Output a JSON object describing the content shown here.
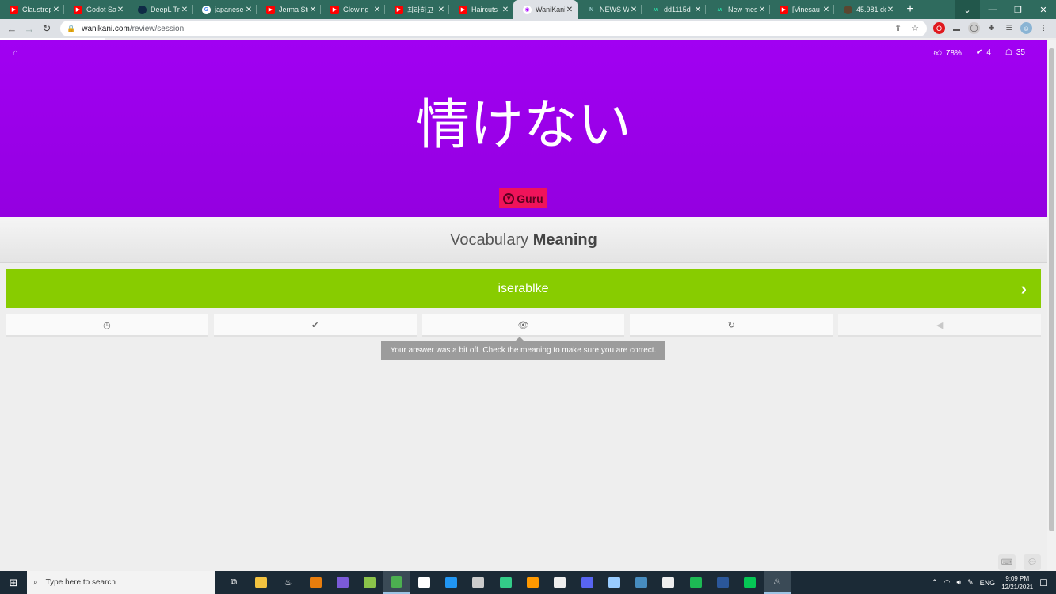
{
  "browser": {
    "tabs": [
      {
        "label": "Claustrop",
        "icon": "youtube-icon"
      },
      {
        "label": "Godot Sa",
        "icon": "youtube-icon"
      },
      {
        "label": "DeepL Tra",
        "icon": "deepl-icon"
      },
      {
        "label": "japanese",
        "icon": "google-icon"
      },
      {
        "label": "Jerma Str",
        "icon": "youtube-icon"
      },
      {
        "label": "Glowing",
        "icon": "youtube-icon"
      },
      {
        "label": "최라하고",
        "icon": "youtube-icon"
      },
      {
        "label": "Haircuts",
        "icon": "youtube-icon"
      },
      {
        "label": "WaniKani",
        "icon": "wanikani-icon"
      },
      {
        "label": "NEWS W",
        "icon": "news-icon"
      },
      {
        "label": "dd1115d",
        "icon": "discord-icon"
      },
      {
        "label": "New mes",
        "icon": "discord-icon"
      },
      {
        "label": "[Vinesau",
        "icon": "youtube-icon"
      },
      {
        "label": "45.981 de",
        "icon": "image-icon"
      }
    ],
    "active_tab_index": 8,
    "url_host": "wanikani.com",
    "url_path": "/review/session",
    "new_tab_label": "+"
  },
  "review": {
    "stats": {
      "percent_correct": "78%",
      "completed": "4",
      "remaining": "35"
    },
    "vocab_word": "情けない",
    "srs_level": "Guru",
    "question_type_prefix": "Vocabulary",
    "question_type_bold": "Meaning",
    "answer_value": "iserablke",
    "tooltip": "Your answer was a bit off. Check the meaning to make sure you are correct.",
    "colors": {
      "vocab_bg": "#a100f2",
      "srs_badge": "#f0135a",
      "answer_correct_bg": "#88cc00"
    }
  },
  "taskbar": {
    "search_placeholder": "Type here to search",
    "lang": "ENG",
    "time": "9:09 PM",
    "date": "12/21/2021"
  }
}
